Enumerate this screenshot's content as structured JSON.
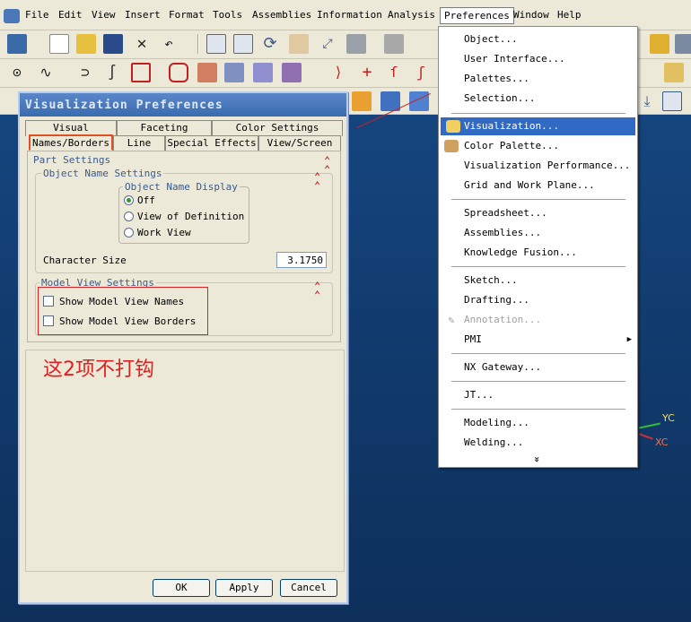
{
  "menubar": {
    "items": [
      "File",
      "Edit",
      "View",
      "Insert",
      "Format",
      "Tools",
      "Assemblies",
      "Information",
      "Analysis",
      "Preferences",
      "Window",
      "Help"
    ]
  },
  "dialog": {
    "title": "Visualization Preferences",
    "tabs_row1": [
      "Visual",
      "Faceting",
      "Color Settings"
    ],
    "tabs_row2": [
      "Names/Borders",
      "Line",
      "Special Effects",
      "View/Screen"
    ],
    "part_settings": "Part Settings",
    "object_name_settings": "Object Name Settings",
    "object_name_display": "Object Name Display",
    "radio_options": [
      "Off",
      "View of Definition",
      "Work View"
    ],
    "selected_radio": "Off",
    "character_size_label": "Character Size",
    "character_size_value": "3.1750",
    "model_view_settings": "Model View Settings",
    "checkboxes": [
      "Show Model View Names",
      "Show Model View Borders"
    ],
    "note": "这2项不打钩",
    "buttons": {
      "ok": "OK",
      "apply": "Apply",
      "cancel": "Cancel"
    }
  },
  "preferences_menu": {
    "group1": [
      "Object...",
      "User Interface...",
      "Palettes...",
      "Selection..."
    ],
    "group2": [
      "Visualization...",
      "Color Palette...",
      "Visualization Performance...",
      "Grid and Work Plane..."
    ],
    "group3": [
      "Spreadsheet...",
      "Assemblies...",
      "Knowledge Fusion..."
    ],
    "group4": [
      "Sketch...",
      "Drafting...",
      "Annotation...",
      "PMI"
    ],
    "group5": [
      "NX Gateway..."
    ],
    "group6": [
      "JT..."
    ],
    "group7": [
      "Modeling...",
      "Welding..."
    ],
    "highlighted": "Visualization...",
    "disabled": "Annotation...",
    "expand": "»"
  },
  "viewport": {
    "yc_label": "YC",
    "xc_label": "XC"
  },
  "colors": {
    "highlight": "#316ac5",
    "annotation_red": "#e02020",
    "title_blue": "#3a6bb0"
  }
}
